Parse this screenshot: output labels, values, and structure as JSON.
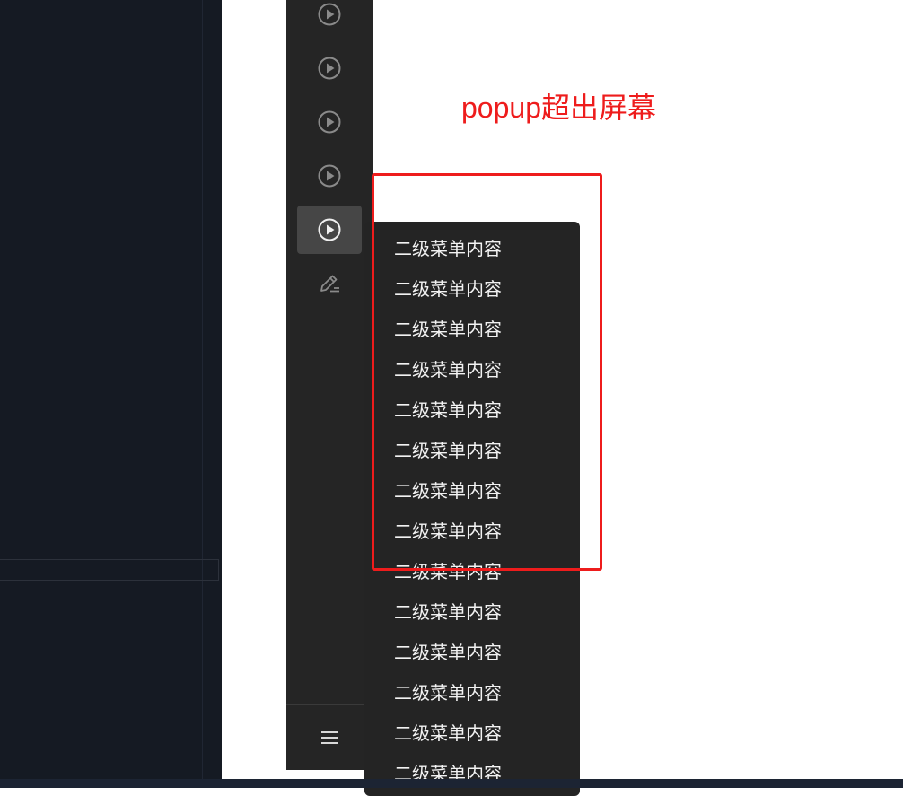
{
  "annotation": {
    "text": "popup超出屏幕",
    "color": "#ee1c1c"
  },
  "toolbar": {
    "buttons": [
      {
        "icon": "play-circle-icon",
        "active": false
      },
      {
        "icon": "play-circle-icon",
        "active": false
      },
      {
        "icon": "play-circle-icon",
        "active": false
      },
      {
        "icon": "play-circle-icon",
        "active": false
      },
      {
        "icon": "play-circle-icon",
        "active": true
      },
      {
        "icon": "edit-pen-icon",
        "active": false
      }
    ],
    "menu_icon": "hamburger-menu-icon"
  },
  "popup": {
    "items": [
      "二级菜单内容",
      "二级菜单内容",
      "二级菜单内容",
      "二级菜单内容",
      "二级菜单内容",
      "二级菜单内容",
      "二级菜单内容",
      "二级菜单内容",
      "二级菜单内容",
      "二级菜单内容",
      "二级菜单内容",
      "二级菜单内容",
      "二级菜单内容",
      "二级菜单内容"
    ]
  },
  "colors": {
    "toolbar_bg": "#252525",
    "popup_bg": "#242424",
    "editor_bg": "#151a23"
  }
}
